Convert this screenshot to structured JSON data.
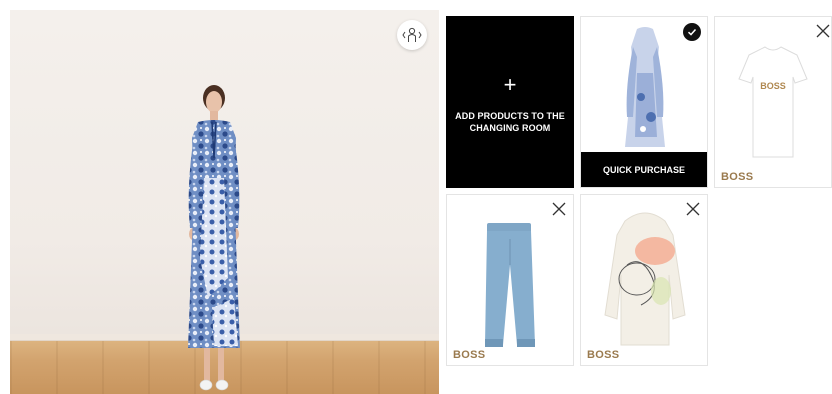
{
  "viewer": {
    "rotate_icon": "rotate-360-icon",
    "model_outfit": "blue floral print maxi dress"
  },
  "add_tile": {
    "plus": "+",
    "label": "ADD PRODUCTS TO THE CHANGING ROOM"
  },
  "products": [
    {
      "brand": "",
      "selected": true,
      "action_label": "QUICK PURCHASE",
      "icon": "check-icon"
    },
    {
      "brand": "BOSS",
      "remove_icon": "close-icon"
    },
    {
      "brand": "BOSS",
      "remove_icon": "close-icon"
    },
    {
      "brand": "BOSS",
      "remove_icon": "close-icon"
    }
  ],
  "colors": {
    "brand_text": "#9a7a4e",
    "add_tile_bg": "#000000",
    "quick_purchase_bg": "#000000"
  }
}
